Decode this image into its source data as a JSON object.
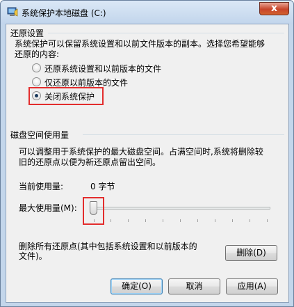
{
  "window": {
    "title": "系统保护本地磁盘 (C:)",
    "close_label": "x"
  },
  "restore": {
    "section_title": "还原设置",
    "description_line1": "系统保护可以保留系统设置和以前文件版本的副本。选择您希望能够",
    "description_line2": "还原的内容:",
    "options": [
      {
        "label": "还原系统设置和以前版本的文件",
        "checked": false
      },
      {
        "label": "仅还原以前版本的文件",
        "checked": false
      },
      {
        "label": "关闭系统保护",
        "checked": true
      }
    ]
  },
  "disk": {
    "section_title": "磁盘空间使用量",
    "description_line1": "可以调整用于系统保护的最大磁盘空间。占满空间时,系统将删除较",
    "description_line2": "旧的还原点以便为新还原点留出空间。",
    "current_usage_label": "当前使用量:",
    "current_usage_value": "0 字节",
    "max_usage_label": "最大使用量(M):",
    "max_usage_fraction": 0.0
  },
  "delete": {
    "text_line1": "删除所有还原点(其中包括系统设置和以前版本的",
    "text_line2": "文件)。",
    "button_label": "删除(D)"
  },
  "footer": {
    "ok_label": "确定(O)",
    "cancel_label": "取消",
    "apply_label": "应用(A)"
  },
  "colors": {
    "highlight": "#e32d2d"
  }
}
